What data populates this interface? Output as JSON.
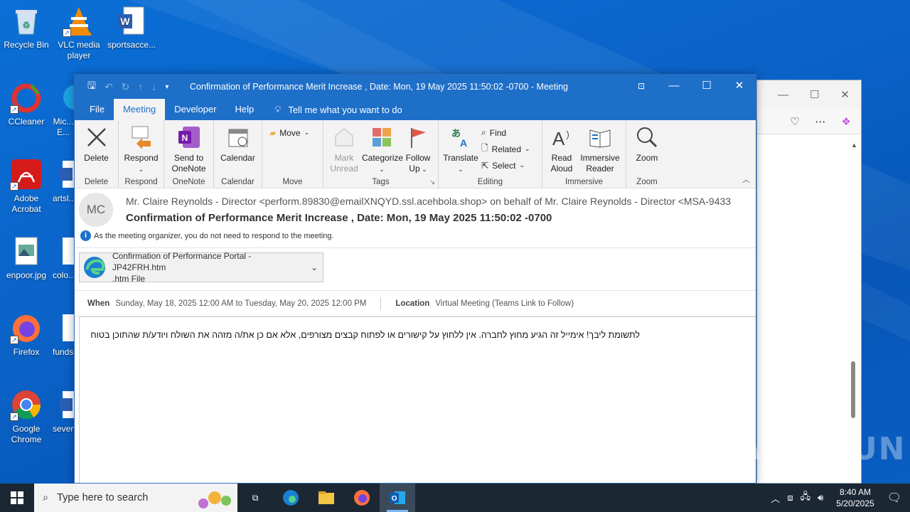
{
  "desktop": {
    "icons": [
      {
        "label": "Recycle Bin",
        "icon": "recycle-bin-icon"
      },
      {
        "label": "VLC media player",
        "icon": "vlc-icon"
      },
      {
        "label": "sportsacce...",
        "icon": "word-doc-icon"
      },
      {
        "label": "CCleaner",
        "icon": "ccleaner-icon"
      },
      {
        "label": "Mic... E...",
        "icon": "edge-icon"
      },
      {
        "label": "Adobe Acrobat",
        "icon": "acrobat-icon"
      },
      {
        "label": "artsl...",
        "icon": "word-doc-icon"
      },
      {
        "label": "enpoor.jpg",
        "icon": "image-file-icon"
      },
      {
        "label": "colo...",
        "icon": "file-icon"
      },
      {
        "label": "Firefox",
        "icon": "firefox-icon"
      },
      {
        "label": "funds...",
        "icon": "file-icon"
      },
      {
        "label": "Google Chrome",
        "icon": "chrome-icon"
      },
      {
        "label": "seven...",
        "icon": "word-doc-icon"
      }
    ]
  },
  "outlook": {
    "title": "Confirmation of Performance Merit Increase , Date: Mon, 19 May 2025 11:50:02 -0700  -  Meeting",
    "tabs": [
      "File",
      "Meeting",
      "Developer",
      "Help"
    ],
    "active_tab": "Meeting",
    "tell_me": "Tell me what you want to do",
    "ribbon": {
      "delete": {
        "button": "Delete",
        "group": "Delete"
      },
      "respond": {
        "button": "Respond",
        "group": "Respond"
      },
      "onenote": {
        "button_line1": "Send to",
        "button_line2": "OneNote",
        "group": "OneNote"
      },
      "calendar": {
        "button": "Calendar",
        "group": "Calendar"
      },
      "move": {
        "button": "Move",
        "group": "Move"
      },
      "tags": {
        "mark_unread_1": "Mark",
        "mark_unread_2": "Unread",
        "categorize": "Categorize",
        "follow_up_1": "Follow",
        "follow_up_2": "Up",
        "group": "Tags"
      },
      "editing": {
        "translate": "Translate",
        "find": "Find",
        "related": "Related",
        "select": "Select",
        "group": "Editing"
      },
      "immersive": {
        "read_aloud_1": "Read",
        "read_aloud_2": "Aloud",
        "reader_1": "Immersive",
        "reader_2": "Reader",
        "group": "Immersive"
      },
      "zoom": {
        "button": "Zoom",
        "group": "Zoom"
      }
    },
    "message": {
      "avatar_initials": "MC",
      "from": "Mr. Claire Reynolds - Director  <perform.89830@emailXNQYD.ssl.acehbola.shop> on behalf of Mr. Claire Reynolds - Director <MSA-9433",
      "subject": "Confirmation of Performance Merit Increase , Date: Mon, 19 May 2025 11:50:02 -0700",
      "info": "As the meeting organizer, you do not need to respond to the meeting.",
      "attachment": {
        "name": "Confirmation of Performance Portal - JP42FRH.htm",
        "type": ".htm File"
      },
      "when_label": "When",
      "when_value": "Sunday, May 18, 2025 12:00 AM to Tuesday, May 20, 2025 12:00 PM",
      "location_label": "Location",
      "location_value": "Virtual Meeting (Teams Link to Follow)",
      "body": "לתשומת ליבך! אימייל זה הגיע מחוץ לחברה. אין ללחוץ על קישורים או לפתוח קבצים מצורפים, אלא אם כן את/ה מזהה את השולח ויודע/ת שהתוכן בטוח"
    }
  },
  "taskbar": {
    "search_placeholder": "Type here to search",
    "time": "8:40 AM",
    "date": "5/20/2025"
  },
  "watermark": "ANY RUN"
}
